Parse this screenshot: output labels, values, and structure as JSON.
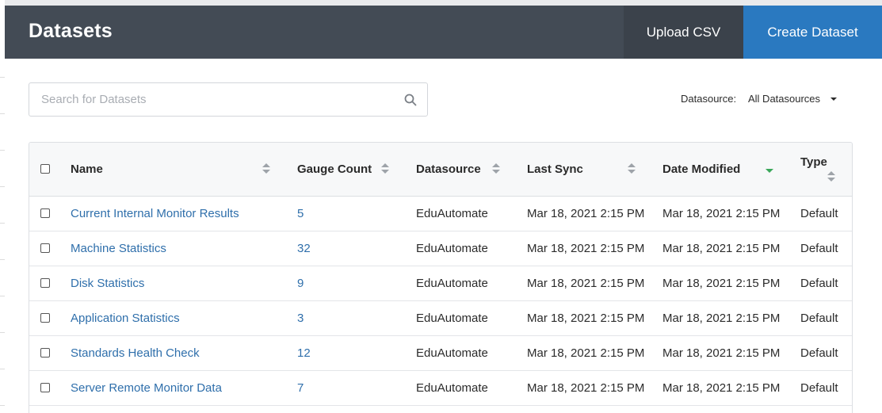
{
  "header": {
    "title": "Datasets",
    "upload_label": "Upload CSV",
    "create_label": "Create Dataset"
  },
  "search": {
    "placeholder": "Search for Datasets",
    "value": ""
  },
  "filter": {
    "label": "Datasource:",
    "selected": "All Datasources"
  },
  "table": {
    "columns": [
      {
        "key": "name",
        "label": "Name",
        "sort": "none"
      },
      {
        "key": "gauge_count",
        "label": "Gauge Count",
        "sort": "none"
      },
      {
        "key": "datasource",
        "label": "Datasource",
        "sort": "none"
      },
      {
        "key": "last_sync",
        "label": "Last Sync",
        "sort": "none"
      },
      {
        "key": "date_modified",
        "label": "Date Modified",
        "sort": "desc"
      },
      {
        "key": "type",
        "label": "Type",
        "sort": "none"
      }
    ],
    "rows": [
      {
        "name": "Current Internal Monitor Results",
        "gauge_count": "5",
        "datasource": "EduAutomate",
        "last_sync": "Mar 18, 2021 2:15 PM",
        "date_modified": "Mar 18, 2021 2:15 PM",
        "type": "Default"
      },
      {
        "name": "Machine Statistics",
        "gauge_count": "32",
        "datasource": "EduAutomate",
        "last_sync": "Mar 18, 2021 2:15 PM",
        "date_modified": "Mar 18, 2021 2:15 PM",
        "type": "Default"
      },
      {
        "name": "Disk Statistics",
        "gauge_count": "9",
        "datasource": "EduAutomate",
        "last_sync": "Mar 18, 2021 2:15 PM",
        "date_modified": "Mar 18, 2021 2:15 PM",
        "type": "Default"
      },
      {
        "name": "Application Statistics",
        "gauge_count": "3",
        "datasource": "EduAutomate",
        "last_sync": "Mar 18, 2021 2:15 PM",
        "date_modified": "Mar 18, 2021 2:15 PM",
        "type": "Default"
      },
      {
        "name": "Standards Health Check",
        "gauge_count": "12",
        "datasource": "EduAutomate",
        "last_sync": "Mar 18, 2021 2:15 PM",
        "date_modified": "Mar 18, 2021 2:15 PM",
        "type": "Default"
      },
      {
        "name": "Server Remote Monitor Data",
        "gauge_count": "7",
        "datasource": "EduAutomate",
        "last_sync": "Mar 18, 2021 2:15 PM",
        "date_modified": "Mar 18, 2021 2:15 PM",
        "type": "Default"
      }
    ]
  },
  "colors": {
    "header_bg": "#434b55",
    "upload_bg": "#3b424b",
    "primary": "#2a79c0",
    "link": "#2f6fab",
    "sort_active": "#3aa75a"
  },
  "icons": {
    "search": "search-icon",
    "sort": "sort-icon",
    "caret": "caret-down-icon"
  }
}
